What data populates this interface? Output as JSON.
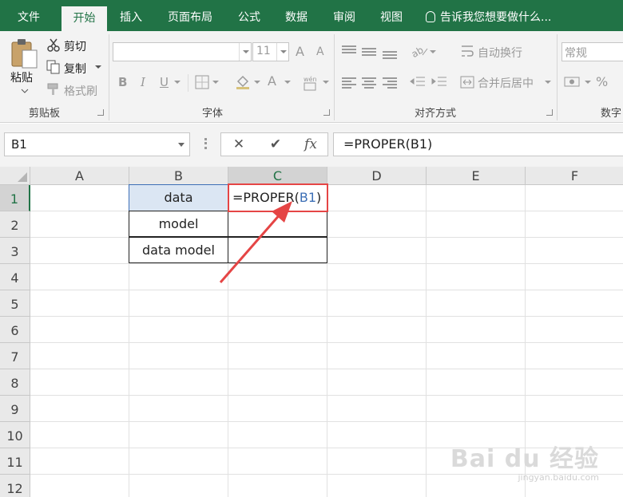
{
  "tabs": [
    "文件",
    "开始",
    "插入",
    "页面布局",
    "公式",
    "数据",
    "审阅",
    "视图"
  ],
  "active_tab": "开始",
  "tell_me": "告诉我您想要做什么...",
  "clipboard": {
    "paste": "粘贴",
    "cut": "剪切",
    "copy": "复制",
    "format_painter": "格式刷",
    "group_label": "剪贴板"
  },
  "font": {
    "font_size": "11",
    "grow_label": "A",
    "shrink_label": "A",
    "bold": "B",
    "italic": "I",
    "underline": "U",
    "font_color_label": "A",
    "group_label": "字体"
  },
  "alignment": {
    "wrap_text": "自动换行",
    "merge_center": "合并后居中",
    "group_label": "对齐方式"
  },
  "number": {
    "format": "常规",
    "percent": "%",
    "group_label": "数字"
  },
  "formula_bar": {
    "name_box": "B1",
    "cancel": "✕",
    "enter": "✔",
    "fx": "fx",
    "formula": "=PROPER(B1)"
  },
  "sheet": {
    "columns": [
      "A",
      "B",
      "C",
      "D",
      "E",
      "F"
    ],
    "rows": [
      "1",
      "2",
      "3",
      "4",
      "5",
      "6",
      "7",
      "8",
      "9",
      "10",
      "11",
      "12"
    ],
    "cells": {
      "B1": "data",
      "B2": "model",
      "B3": "data model",
      "C1_prefix": "=PROPER(",
      "C1_ref": "B1",
      "C1_suffix": ")"
    },
    "selected_column": "C",
    "selected_row": "1"
  },
  "colors": {
    "ribbon_green": "#217346",
    "annotation_red": "#e54545",
    "reference_blue": "#3d6fb6"
  },
  "watermark": {
    "brand": "Bai du 经验",
    "url": "jingyan.baidu.com"
  }
}
